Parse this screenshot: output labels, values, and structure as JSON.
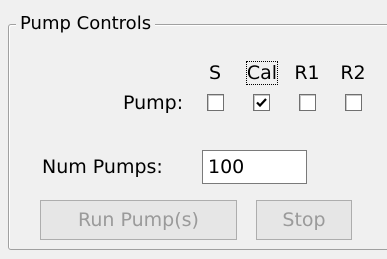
{
  "group": {
    "title": "Pump Controls"
  },
  "columns": [
    "S",
    "Cal",
    "R1",
    "R2"
  ],
  "pump_row": {
    "label": "Pump:",
    "checks": [
      false,
      true,
      false,
      false
    ]
  },
  "num_pumps": {
    "label": "Num Pumps:",
    "value": "100"
  },
  "buttons": {
    "run": "Run Pump(s)",
    "stop": "Stop"
  },
  "colors": {
    "background": "#f0f0f0",
    "disabled_text": "#9a9a9a",
    "border": "#a0a0a0"
  }
}
